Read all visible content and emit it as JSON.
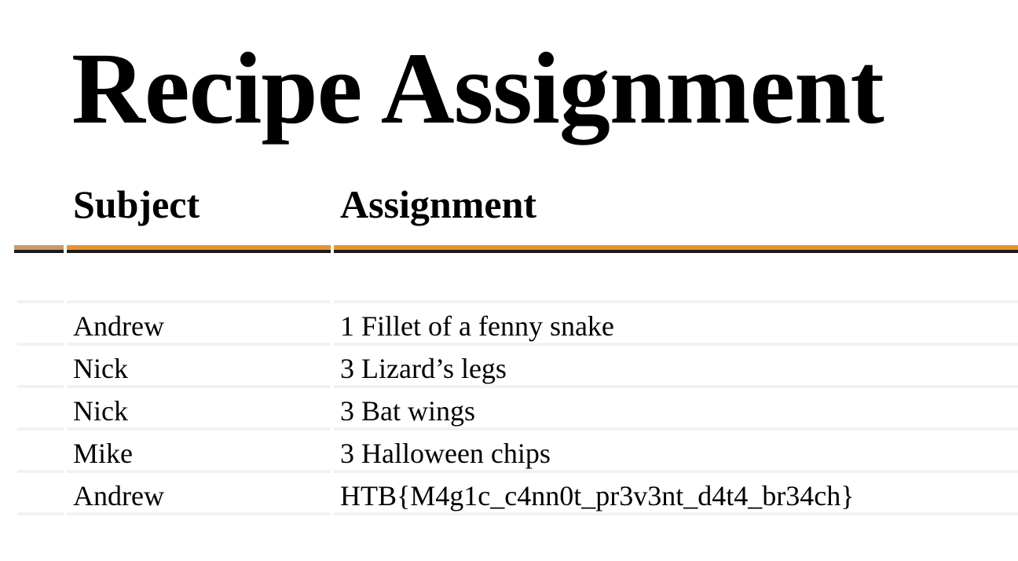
{
  "page": {
    "title": "Recipe Assignment"
  },
  "table": {
    "headers": {
      "subject": "Subject",
      "assignment": "Assignment"
    },
    "rows": [
      {
        "subject": "Andrew",
        "assignment": "1 Fillet of a fenny snake"
      },
      {
        "subject": "Nick",
        "assignment": "3 Lizard’s legs"
      },
      {
        "subject": "Nick",
        "assignment": "3 Bat wings"
      },
      {
        "subject": "Mike",
        "assignment": "3 Halloween chips"
      },
      {
        "subject": "Andrew",
        "assignment": "HTB{M4g1c_c4nn0t_pr3v3nt_d4t4_br34ch}"
      }
    ]
  },
  "colors": {
    "header_accent": "#e8942f",
    "row_divider": "#f2f2f2"
  }
}
